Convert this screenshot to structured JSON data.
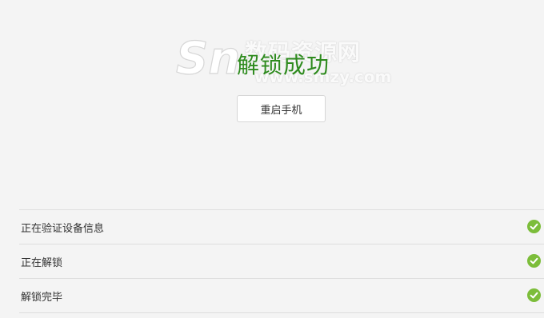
{
  "watermark": {
    "logo_text": "Sn",
    "site_name": "数码资源网",
    "url": "www.smzy.com"
  },
  "result": {
    "title": "解锁成功",
    "color": "#2e8b1e"
  },
  "restart_button": {
    "label": "重启手机"
  },
  "steps": [
    {
      "label": "正在验证设备信息",
      "status": "done",
      "icon": "check-circle-icon"
    },
    {
      "label": "正在解锁",
      "status": "done",
      "icon": "check-circle-icon"
    },
    {
      "label": "解锁完毕",
      "status": "done",
      "icon": "check-circle-icon"
    }
  ],
  "colors": {
    "background": "#f4f4f4",
    "check": "#7cbd3a",
    "divider": "#dedede"
  }
}
